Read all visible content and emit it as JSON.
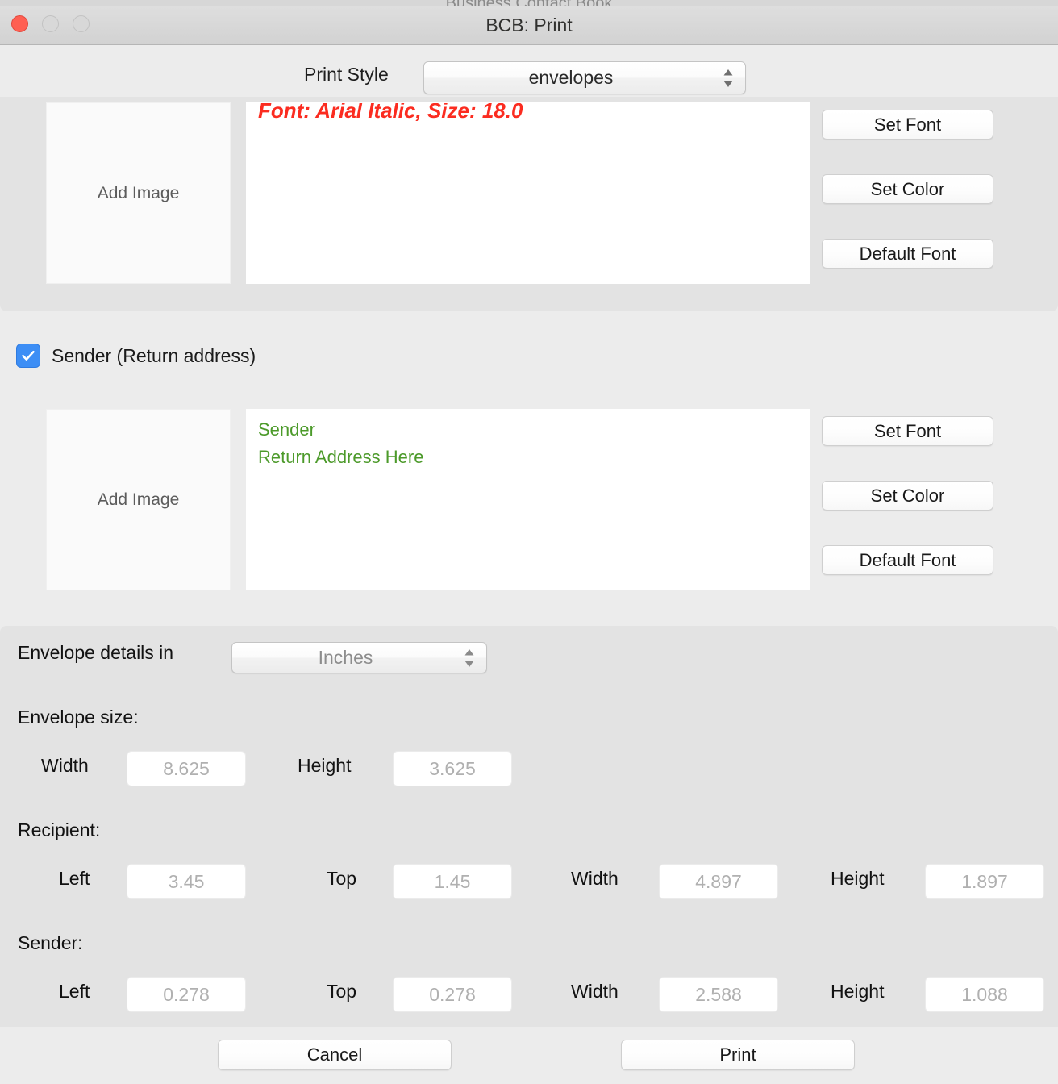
{
  "background_window": {
    "title": "Business Contact Book"
  },
  "window": {
    "title": "BCB: Print",
    "traffic_lights": {
      "close": "close-button",
      "minimize": "minimize-button",
      "zoom": "zoom-button"
    }
  },
  "print_style": {
    "label": "Print Style",
    "value": "envelopes"
  },
  "recipient_section": {
    "add_image_label": "Add Image",
    "preview_text": "Font: Arial Italic, Size: 18.0",
    "preview_color": "#fb2c20",
    "buttons": {
      "set_font": "Set Font",
      "set_color": "Set Color",
      "default_font": "Default Font"
    }
  },
  "sender_section": {
    "checkbox_label": "Sender (Return address)",
    "checkbox_checked": true,
    "add_image_label": "Add Image",
    "preview_lines": [
      "Sender",
      "Return Address Here"
    ],
    "preview_color": "#4c9a2a",
    "buttons": {
      "set_font": "Set Font",
      "set_color": "Set Color",
      "default_font": "Default Font"
    }
  },
  "envelope_details": {
    "units_label": "Envelope details in",
    "units_value": "Inches",
    "size_label": "Envelope size:",
    "size_fields": [
      {
        "label": "Width",
        "value": "8.625"
      },
      {
        "label": "Height",
        "value": "3.625"
      }
    ],
    "recipient_label": "Recipient:",
    "recipient_fields": [
      {
        "label": "Left",
        "value": "3.45"
      },
      {
        "label": "Top",
        "value": "1.45"
      },
      {
        "label": "Width",
        "value": "4.897"
      },
      {
        "label": "Height",
        "value": "1.897"
      }
    ],
    "sender_label": "Sender:",
    "sender_fields": [
      {
        "label": "Left",
        "value": "0.278"
      },
      {
        "label": "Top",
        "value": "0.278"
      },
      {
        "label": "Width",
        "value": "2.588"
      },
      {
        "label": "Height",
        "value": "1.088"
      }
    ]
  },
  "footer": {
    "cancel_label": "Cancel",
    "print_label": "Print"
  },
  "colors": {
    "accent_checkbox": "#3d8ef5",
    "close_button": "#ff5f52",
    "recipient_text": "#fb2c20",
    "sender_text": "#4c9a2a",
    "window_background": "#ececec",
    "group_background": "#e3e3e3"
  }
}
